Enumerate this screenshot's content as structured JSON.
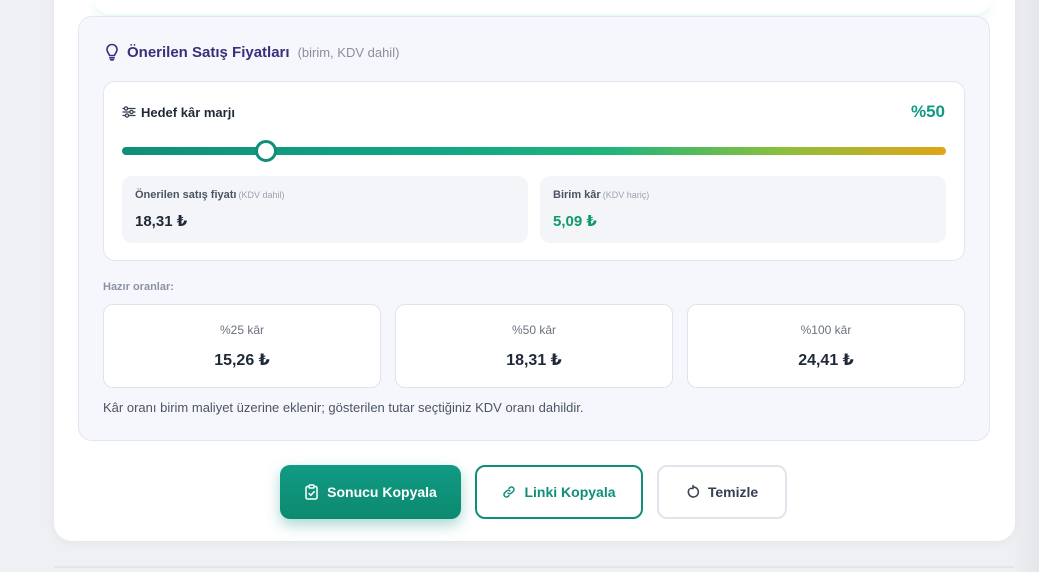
{
  "panel": {
    "title": "Önerilen Satış Fiyatları",
    "subtitle": "(birim, KDV dahil)"
  },
  "margin": {
    "label": "Hedef kâr marjı",
    "value_text": "%50",
    "slider_value_fraction": 0.175
  },
  "stats": {
    "suggested_price": {
      "label": "Önerilen satış fiyatı",
      "note": "(KDV dahil)",
      "value": "18,31 ₺"
    },
    "unit_profit": {
      "label": "Birim kâr",
      "note": "(KDV hariç)",
      "value": "5,09 ₺"
    }
  },
  "presets": {
    "title": "Hazır oranlar:",
    "items": [
      {
        "label": "%25 kâr",
        "value": "15,26 ₺"
      },
      {
        "label": "%50 kâr",
        "value": "18,31 ₺"
      },
      {
        "label": "%100 kâr",
        "value": "24,41 ₺"
      }
    ]
  },
  "note": "Kâr oranı birim maliyet üzerine eklenir; gösterilen tutar seçtiğiniz KDV oranı dahildir.",
  "buttons": {
    "copy_result": "Sonucu Kopyala",
    "copy_link": "Linki Kopyala",
    "clear": "Temizle"
  },
  "colors": {
    "accent": "#0f8f7a",
    "title": "#3b2f7a",
    "profit": "#0f9a6a"
  },
  "icons": {
    "title": "lightbulb-icon",
    "margin": "sliders-icon",
    "copy_result": "clipboard-icon",
    "copy_link": "link-icon",
    "clear": "refresh-icon"
  }
}
